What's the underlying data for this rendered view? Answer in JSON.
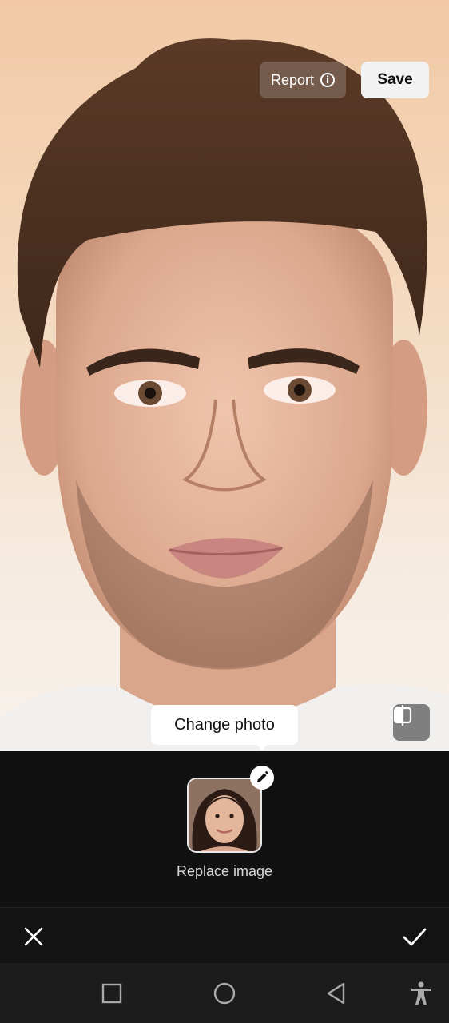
{
  "header": {
    "report_label": "Report",
    "save_label": "Save"
  },
  "tooltip": {
    "text": "Change photo"
  },
  "replace": {
    "label": "Replace image"
  },
  "icons": {
    "report": "info-icon",
    "compare": "compare-icon",
    "edit": "pencil-icon",
    "close": "close-icon",
    "confirm": "check-icon",
    "nav_recents": "square-icon",
    "nav_home": "circle-icon",
    "nav_back": "back-triangle-icon",
    "nav_accessibility": "accessibility-icon"
  },
  "colors": {
    "panel_bg": "#111111",
    "navbar_bg": "#1c1c1c",
    "save_bg": "#f2f2f2",
    "accent_white": "#ffffff"
  }
}
